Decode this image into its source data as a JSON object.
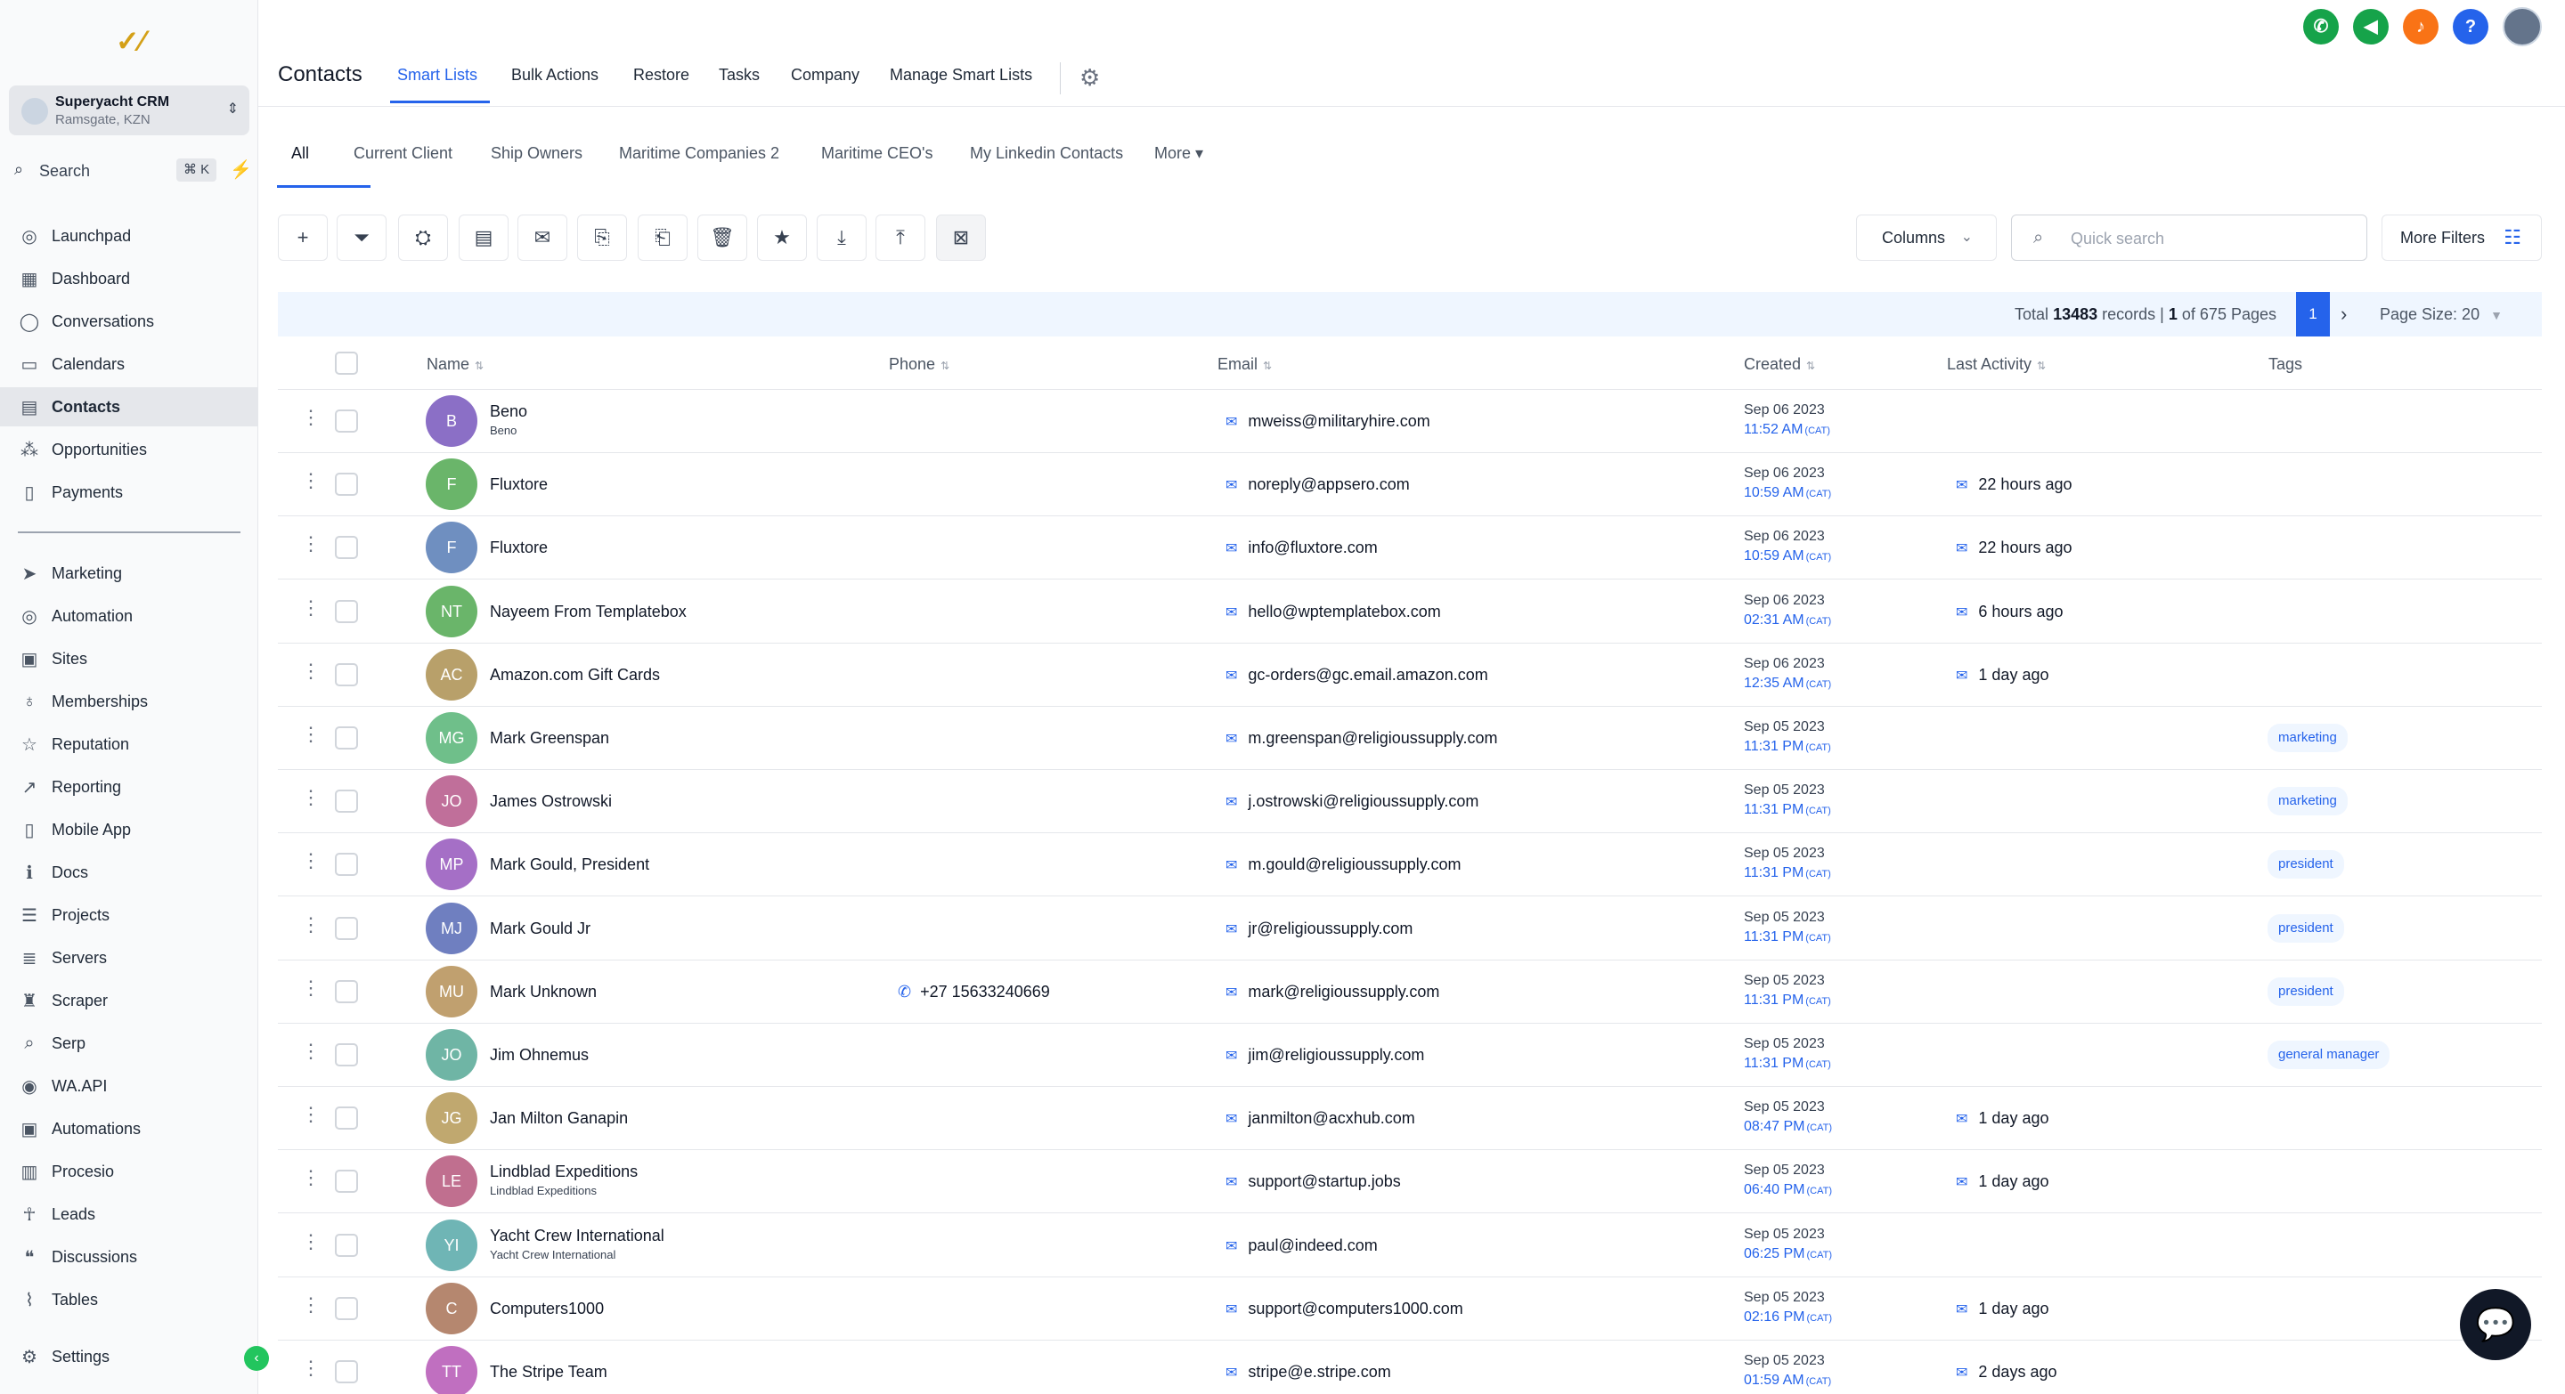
{
  "sidebar": {
    "logo": "✓⁄",
    "account": {
      "name": "Superyacht CRM",
      "location": "Ramsgate, KZN"
    },
    "search": {
      "label": "Search",
      "shortcut": "⌘ K"
    },
    "items_top": [
      {
        "label": "Launchpad",
        "icon": "rocket-icon",
        "glyph": "◎"
      },
      {
        "label": "Dashboard",
        "icon": "dashboard-icon",
        "glyph": "▦"
      },
      {
        "label": "Conversations",
        "icon": "chat-icon",
        "glyph": "◯"
      },
      {
        "label": "Calendars",
        "icon": "calendar-icon",
        "glyph": "▭"
      },
      {
        "label": "Contacts",
        "icon": "contacts-icon",
        "glyph": "▤"
      },
      {
        "label": "Opportunities",
        "icon": "opportunities-icon",
        "glyph": "⁂"
      },
      {
        "label": "Payments",
        "icon": "payments-icon",
        "glyph": "▯"
      }
    ],
    "items_bottom": [
      {
        "label": "Marketing",
        "icon": "send-icon",
        "glyph": "➤"
      },
      {
        "label": "Automation",
        "icon": "automation-icon",
        "glyph": "◎"
      },
      {
        "label": "Sites",
        "icon": "sites-icon",
        "glyph": "▣"
      },
      {
        "label": "Memberships",
        "icon": "membership-icon",
        "glyph": "♁"
      },
      {
        "label": "Reputation",
        "icon": "star-icon",
        "glyph": "☆"
      },
      {
        "label": "Reporting",
        "icon": "reporting-icon",
        "glyph": "↗"
      },
      {
        "label": "Mobile App",
        "icon": "mobile-icon",
        "glyph": "▯"
      },
      {
        "label": "Docs",
        "icon": "info-icon",
        "glyph": "ℹ"
      },
      {
        "label": "Projects",
        "icon": "projects-icon",
        "glyph": "☰"
      },
      {
        "label": "Servers",
        "icon": "servers-icon",
        "glyph": "≣"
      },
      {
        "label": "Scraper",
        "icon": "scraper-icon",
        "glyph": "♜"
      },
      {
        "label": "Serp",
        "icon": "serp-icon",
        "glyph": "⌕"
      },
      {
        "label": "WA.API",
        "icon": "whatsapp-icon",
        "glyph": "◉"
      },
      {
        "label": "Automations",
        "icon": "automations-icon",
        "glyph": "▣"
      },
      {
        "label": "Procesio",
        "icon": "procesio-icon",
        "glyph": "▥"
      },
      {
        "label": "Leads",
        "icon": "leads-icon",
        "glyph": "☥"
      },
      {
        "label": "Discussions",
        "icon": "discussions-icon",
        "glyph": "❝"
      },
      {
        "label": "Tables",
        "icon": "tables-icon",
        "glyph": "⌇"
      }
    ],
    "settings": {
      "label": "Settings",
      "glyph": "⚙"
    }
  },
  "header": {
    "title": "Contacts",
    "tabs": [
      "Smart Lists",
      "Bulk Actions",
      "Restore",
      "Tasks",
      "Company",
      "Manage Smart Lists"
    ],
    "active_tab": "Smart Lists"
  },
  "top_actions": [
    {
      "icon": "phone-icon",
      "glyph": "✆",
      "color": "#16a34a"
    },
    {
      "icon": "megaphone-icon",
      "glyph": "◀",
      "color": "#16a34a"
    },
    {
      "icon": "bell-icon",
      "glyph": "♪",
      "color": "#f97316"
    },
    {
      "icon": "help-icon",
      "glyph": "?",
      "color": "#2563eb"
    }
  ],
  "smart_lists": {
    "tabs": [
      "All",
      "Current Client",
      "Ship Owners",
      "Maritime Companies 2",
      "Maritime CEO's",
      "My Linkedin Contacts",
      "More ▾"
    ],
    "active": "All"
  },
  "toolbar": {
    "buttons": [
      {
        "icon": "add-icon",
        "glyph": "+"
      },
      {
        "icon": "filter-icon",
        "glyph": "⏷"
      },
      {
        "icon": "robot-icon",
        "glyph": "⛭"
      },
      {
        "icon": "message-icon",
        "glyph": "▤"
      },
      {
        "icon": "email-icon",
        "glyph": "✉"
      },
      {
        "icon": "tag-add-icon",
        "glyph": "⎘"
      },
      {
        "icon": "tag-remove-icon",
        "glyph": "⎗"
      },
      {
        "icon": "delete-icon",
        "glyph": "🗑"
      },
      {
        "icon": "star-icon",
        "glyph": "★"
      },
      {
        "icon": "import-icon",
        "glyph": "⤓"
      },
      {
        "icon": "export-icon",
        "glyph": "⤒"
      },
      {
        "icon": "merge-icon",
        "glyph": "⊠"
      }
    ],
    "columns_label": "Columns",
    "quick_search_placeholder": "Quick search",
    "more_filters_label": "More Filters"
  },
  "pagination": {
    "prefix": "Total",
    "total": "13483",
    "records_text": "records |",
    "page": "1",
    "of_text": "of 675 Pages",
    "current_page": "1",
    "page_size": "Page Size: 20"
  },
  "table": {
    "columns": [
      "Name",
      "Phone",
      "Email",
      "Created",
      "Last Activity",
      "Tags"
    ],
    "rows": [
      {
        "initials": "B",
        "color": "#8b6fc6",
        "name": "Beno",
        "sub": "Beno",
        "phone": "",
        "email": "mweiss@militaryhire.com",
        "date": "Sep 06 2023",
        "time": "11:52 AM",
        "tz": "(CAT)",
        "activity": "",
        "tag": ""
      },
      {
        "initials": "F",
        "color": "#6ab56a",
        "name": "Fluxtore",
        "sub": "",
        "phone": "",
        "email": "noreply@appsero.com",
        "date": "Sep 06 2023",
        "time": "10:59 AM",
        "tz": "(CAT)",
        "activity": "22 hours ago",
        "tag": ""
      },
      {
        "initials": "F",
        "color": "#6f8fc0",
        "name": "Fluxtore",
        "sub": "",
        "phone": "",
        "email": "info@fluxtore.com",
        "date": "Sep 06 2023",
        "time": "10:59 AM",
        "tz": "(CAT)",
        "activity": "22 hours ago",
        "tag": ""
      },
      {
        "initials": "NT",
        "color": "#6ab56a",
        "name": "Nayeem From Templatebox",
        "sub": "",
        "phone": "",
        "email": "hello@wptemplatebox.com",
        "date": "Sep 06 2023",
        "time": "02:31 AM",
        "tz": "(CAT)",
        "activity": "6 hours ago",
        "tag": ""
      },
      {
        "initials": "AC",
        "color": "#b8a06a",
        "name": "Amazon.com Gift Cards",
        "sub": "",
        "phone": "",
        "email": "gc-orders@gc.email.amazon.com",
        "date": "Sep 06 2023",
        "time": "12:35 AM",
        "tz": "(CAT)",
        "activity": "1 day ago",
        "tag": ""
      },
      {
        "initials": "MG",
        "color": "#6fbf8a",
        "name": "Mark Greenspan",
        "sub": "",
        "phone": "",
        "email": "m.greenspan@religioussupply.com",
        "date": "Sep 05 2023",
        "time": "11:31 PM",
        "tz": "(CAT)",
        "activity": "",
        "tag": "marketing"
      },
      {
        "initials": "JO",
        "color": "#c06f9a",
        "name": "James Ostrowski",
        "sub": "",
        "phone": "",
        "email": "j.ostrowski@religioussupply.com",
        "date": "Sep 05 2023",
        "time": "11:31 PM",
        "tz": "(CAT)",
        "activity": "",
        "tag": "marketing"
      },
      {
        "initials": "MP",
        "color": "#a56fc6",
        "name": "Mark Gould, President",
        "sub": "",
        "phone": "",
        "email": "m.gould@religioussupply.com",
        "date": "Sep 05 2023",
        "time": "11:31 PM",
        "tz": "(CAT)",
        "activity": "",
        "tag": "president"
      },
      {
        "initials": "MJ",
        "color": "#6f7fc0",
        "name": "Mark Gould Jr",
        "sub": "",
        "phone": "",
        "email": "jr@religioussupply.com",
        "date": "Sep 05 2023",
        "time": "11:31 PM",
        "tz": "(CAT)",
        "activity": "",
        "tag": "president"
      },
      {
        "initials": "MU",
        "color": "#c0a06f",
        "name": "Mark Unknown",
        "sub": "",
        "phone": "+27 15633240669",
        "email": "mark@religioussupply.com",
        "date": "Sep 05 2023",
        "time": "11:31 PM",
        "tz": "(CAT)",
        "activity": "",
        "tag": "president"
      },
      {
        "initials": "JO",
        "color": "#6fb5a5",
        "name": "Jim Ohnemus",
        "sub": "",
        "phone": "",
        "email": "jim@religioussupply.com",
        "date": "Sep 05 2023",
        "time": "11:31 PM",
        "tz": "(CAT)",
        "activity": "",
        "tag": "general manager"
      },
      {
        "initials": "JG",
        "color": "#c0a86f",
        "name": "Jan Milton Ganapin",
        "sub": "",
        "phone": "",
        "email": "janmilton@acxhub.com",
        "date": "Sep 05 2023",
        "time": "08:47 PM",
        "tz": "(CAT)",
        "activity": "1 day ago",
        "tag": ""
      },
      {
        "initials": "LE",
        "color": "#c06f8f",
        "name": "Lindblad Expeditions",
        "sub": "Lindblad Expeditions",
        "phone": "",
        "email": "support@startup.jobs",
        "date": "Sep 05 2023",
        "time": "06:40 PM",
        "tz": "(CAT)",
        "activity": "1 day ago",
        "tag": ""
      },
      {
        "initials": "YI",
        "color": "#6fb5b5",
        "name": "Yacht Crew International",
        "sub": "Yacht Crew International",
        "phone": "",
        "email": "paul@indeed.com",
        "date": "Sep 05 2023",
        "time": "06:25 PM",
        "tz": "(CAT)",
        "activity": "",
        "tag": ""
      },
      {
        "initials": "C",
        "color": "#b5876f",
        "name": "Computers1000",
        "sub": "",
        "phone": "",
        "email": "support@computers1000.com",
        "date": "Sep 05 2023",
        "time": "02:16 PM",
        "tz": "(CAT)",
        "activity": "1 day ago",
        "tag": ""
      },
      {
        "initials": "TT",
        "color": "#c06fc0",
        "name": "The Stripe Team",
        "sub": "",
        "phone": "",
        "email": "stripe@e.stripe.com",
        "date": "Sep 05 2023",
        "time": "01:59 AM",
        "tz": "(CAT)",
        "activity": "2 days ago",
        "tag": ""
      }
    ]
  },
  "colors": {
    "accent": "#2563eb",
    "success": "#22c55e",
    "warning": "#f97316"
  }
}
